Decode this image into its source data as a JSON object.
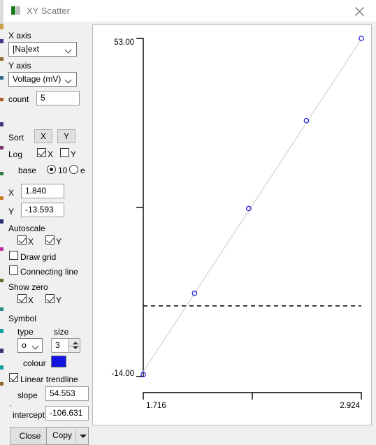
{
  "window": {
    "title": "XY Scatter",
    "icon": "chart-icon",
    "close_label": "close-icon"
  },
  "panel": {
    "x_axis_label": "X axis",
    "x_axis_value": "[Na]ext",
    "y_axis_label": "Y axis",
    "y_axis_value": "Voltage (mV)",
    "count_label": "count",
    "count_value": "5",
    "sort_label": "Sort",
    "sort_x": "X",
    "sort_y": "Y",
    "log_label": "Log",
    "log_x_label": "X",
    "log_x_checked": true,
    "log_y_label": "Y",
    "log_y_checked": false,
    "base_label": "base",
    "base_10_label": "10",
    "base_10_selected": true,
    "base_e_label": "e",
    "base_e_selected": false,
    "x_label": "X",
    "x_value": "1.840",
    "y_label": "Y",
    "y_value": "-13.593",
    "autoscale_label": "Autoscale",
    "autoscale_x_label": "X",
    "autoscale_x_checked": true,
    "autoscale_y_label": "Y",
    "autoscale_y_checked": true,
    "draw_grid_label": "Draw grid",
    "draw_grid_checked": false,
    "connecting_line_label": "Connecting line",
    "connecting_line_checked": false,
    "show_zero_label": "Show zero",
    "show_zero_x_label": "X",
    "show_zero_x_checked": true,
    "show_zero_y_label": "Y",
    "show_zero_y_checked": true,
    "symbol_label": "Symbol",
    "symbol_type_label": "type",
    "symbol_type_value": "o",
    "symbol_size_label": "size",
    "symbol_size_value": "3",
    "colour_label": "colour",
    "colour_value": "#1414e1",
    "trendline_label": "Linear trendline",
    "trendline_checked": true,
    "slope_label": "slope",
    "slope_value": "54.553",
    "intercept_label": "intercept",
    "intercept_value": "-106.631",
    "close_button": "Close",
    "copy_button": "Copy"
  },
  "chart_data": {
    "type": "scatter",
    "title": "",
    "xlabel": "",
    "ylabel": "",
    "xlim": [
      1.716,
      2.924
    ],
    "ylim": [
      -14.0,
      53.0
    ],
    "x_tick_labels": [
      "1.716",
      "2.924"
    ],
    "y_tick_labels": [
      "53.00",
      "-14.00"
    ],
    "grid": false,
    "legend": false,
    "zero_line": true,
    "marker": "o",
    "marker_colour": "#1414e1",
    "trendline": {
      "visible": true,
      "colour": "#d0d0d0",
      "slope": 54.553,
      "intercept": -106.631
    },
    "points": [
      {
        "x": 1.716,
        "y": -13.593
      },
      {
        "x": 2.0,
        "y": 2.5
      },
      {
        "x": 2.3,
        "y": 19.3
      },
      {
        "x": 2.62,
        "y": 36.7
      },
      {
        "x": 2.924,
        "y": 53.0
      }
    ]
  }
}
